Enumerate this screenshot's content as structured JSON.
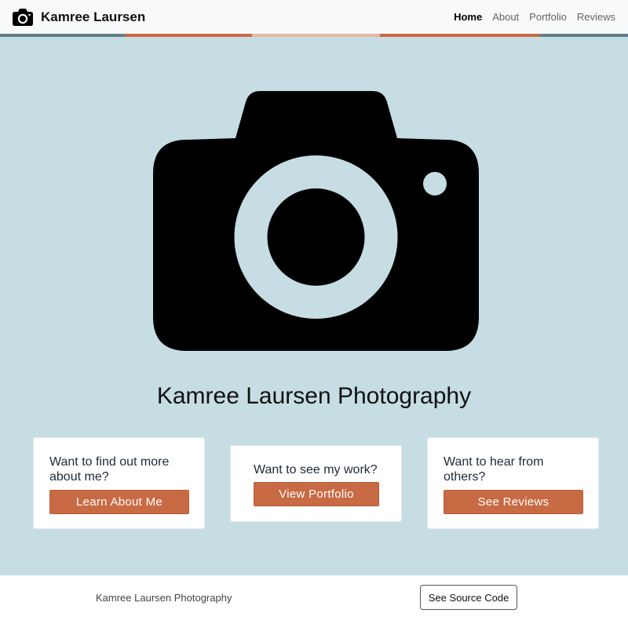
{
  "header": {
    "brand": "Kamree Laursen",
    "nav": [
      {
        "label": "Home",
        "active": true
      },
      {
        "label": "About",
        "active": false
      },
      {
        "label": "Portfolio",
        "active": false
      },
      {
        "label": "Reviews",
        "active": false
      }
    ]
  },
  "stripe_colors": [
    "#5f7d8c",
    "#c86a43",
    "#e2b8a4",
    "#c86a43",
    "#5f7d8c"
  ],
  "hero": {
    "icon": "camera-icon",
    "title": "Kamree Laursen Photography"
  },
  "cards": [
    {
      "text": "Want to find out more about me?",
      "button": "Learn About Me"
    },
    {
      "text": "Want to see my work?",
      "button": "View Portfolio"
    },
    {
      "text": "Want to hear from others?",
      "button": "See Reviews"
    }
  ],
  "footer": {
    "text": "Kamree Laursen Photography",
    "button": "See Source Code"
  },
  "colors": {
    "background": "#c5dde3",
    "accent": "#c86a43",
    "navbar": "#f8f9fa"
  }
}
